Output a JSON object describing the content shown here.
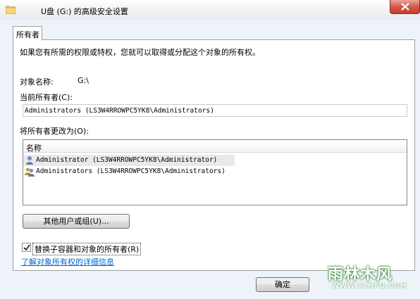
{
  "window": {
    "title": "U盘 (G:) 的高级安全设置"
  },
  "tabs": [
    {
      "label": "所有者"
    }
  ],
  "panel": {
    "intro": "如果您有所需的权限或特权，您就可以取得或分配这个对象的所有权。",
    "object_name_label": "对象名称:",
    "object_name_value": "G:\\",
    "current_owner_label": "当前所有者(C):",
    "current_owner_value": "Administrators (LS3W4RROWPC5YK8\\Administrators)",
    "change_owner_label": "将所有者更改为(O):",
    "list": {
      "header": "名称",
      "items": [
        {
          "label": "Administrator (LS3W4RROWPC5YK8\\Administrator)",
          "icon": "user-icon",
          "selected": true
        },
        {
          "label": "Administrators (LS3W4RROWPC5YK8\\Administrators)",
          "icon": "group-icon",
          "selected": false
        }
      ]
    },
    "other_users_button": "其他用户或组(U)...",
    "replace_checkbox": {
      "label": "替换子容器和对象的所有者(R)",
      "checked": true
    },
    "learn_link": "了解对象所有权的详细信息"
  },
  "footer": {
    "ok_button": "确定"
  },
  "watermark": {
    "main": "雨林木风",
    "sub": "WWW.YLMFU.COM"
  }
}
